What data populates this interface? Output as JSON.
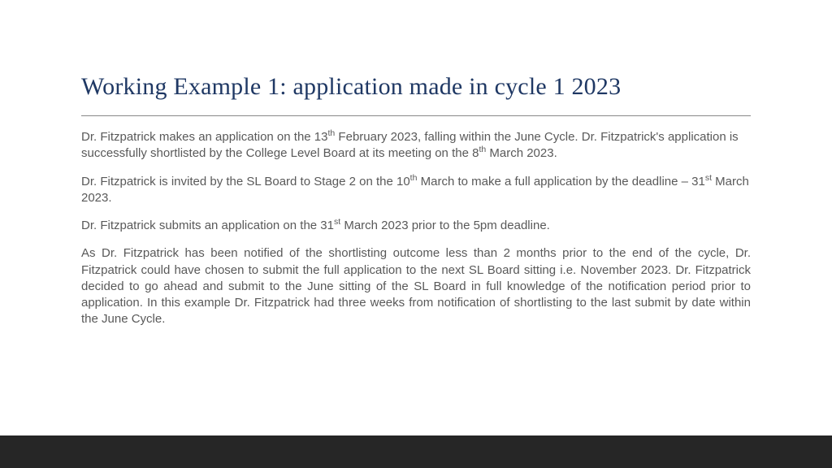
{
  "slide": {
    "title": "Working Example 1: application made in cycle 1 2023",
    "paragraphs": [
      {
        "segments": [
          {
            "text": "Dr. Fitzpatrick makes an application on the 13"
          },
          {
            "text": "th",
            "sup": true
          },
          {
            "text": " February 2023, falling within the June Cycle. Dr. Fitzpatrick's application is successfully shortlisted by the College Level Board at its meeting on the 8"
          },
          {
            "text": "th",
            "sup": true
          },
          {
            "text": " March 2023."
          }
        ],
        "justify": false
      },
      {
        "segments": [
          {
            "text": "Dr. Fitzpatrick is invited by the SL Board to Stage 2 on the 10"
          },
          {
            "text": "th",
            "sup": true
          },
          {
            "text": " March to make a full application by the deadline – 31"
          },
          {
            "text": "st",
            "sup": true
          },
          {
            "text": " March 2023."
          }
        ],
        "justify": false
      },
      {
        "segments": [
          {
            "text": "Dr. Fitzpatrick submits an application on the 31"
          },
          {
            "text": "st",
            "sup": true
          },
          {
            "text": " March 2023 prior to the 5pm deadline."
          }
        ],
        "justify": false
      },
      {
        "segments": [
          {
            "text": "As Dr. Fitzpatrick has been notified of the shortlisting outcome less than 2 months prior to the end of the cycle, Dr. Fitzpatrick could have chosen to submit the full application to the next SL Board sitting i.e. November 2023. Dr. Fitzpatrick decided to go ahead and submit to the June sitting of the SL Board in full knowledge of the notification period prior to application. In this example Dr. Fitzpatrick had three weeks from notification of shortlisting to the last submit by date within the June Cycle."
          }
        ],
        "justify": true
      }
    ]
  }
}
